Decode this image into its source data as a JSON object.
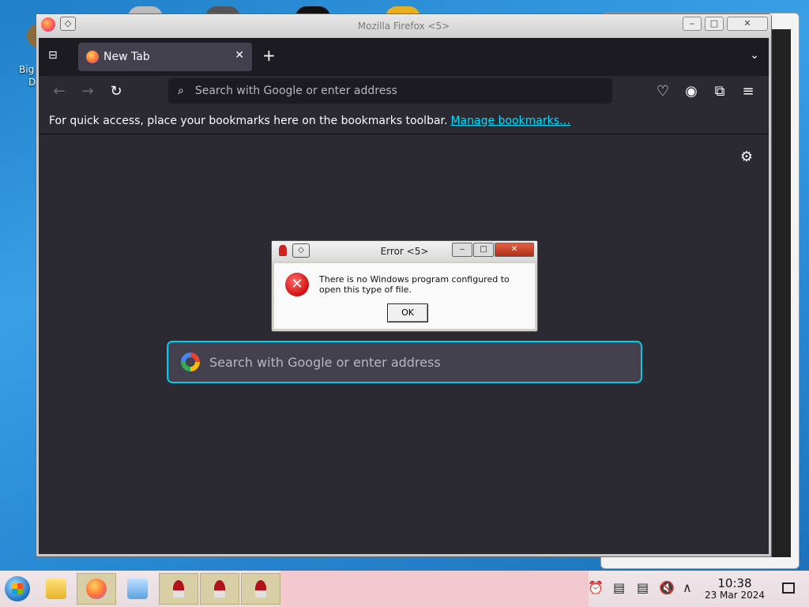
{
  "desktop": {
    "icon_label_line1": "Big",
    "icon_label_line2": "D"
  },
  "window": {
    "title": "Mozilla Firefox <5>",
    "pin_glyph": "◇",
    "minimize": "‒",
    "maximize": "□",
    "close": "✕"
  },
  "browser": {
    "tab_list_glyph": "⊟",
    "tab": {
      "label": "New Tab",
      "close": "✕"
    },
    "newtab_glyph": "+",
    "tablist_menu_glyph": "⌄",
    "nav": {
      "back": "←",
      "forward": "→",
      "reload": "↻",
      "search_glyph": "⌕",
      "urlbar_placeholder": "Search with Google or enter address",
      "pocket": "♡",
      "account": "◉",
      "extensions": "⧉",
      "menu": "≡"
    },
    "bookmarks_bar": {
      "text": "For quick access, place your bookmarks here on the bookmarks toolbar.",
      "link": "Manage bookmarks…"
    },
    "newtab": {
      "settings_glyph": "⚙",
      "search_placeholder": "Search with Google or enter address"
    }
  },
  "dialog": {
    "title": "Error <5>",
    "pin_glyph": "◇",
    "minimize": "‒",
    "maximize": "□",
    "close": "✕",
    "error_glyph": "✕",
    "message": "There is no Windows program configured to open this type of file.",
    "ok": "OK"
  },
  "taskbar": {
    "tray": {
      "alarm": "⏰",
      "clipboard": "▤",
      "mute": "🔇",
      "expand": "∧"
    },
    "clock": {
      "time": "10:38",
      "date": "23 Mar 2024"
    }
  },
  "colors": {
    "ff_bg": "#2b2a33",
    "ff_tabstrip": "#1c1b22",
    "accent_cyan": "#00ddff",
    "taskbar": "#f0e6ea"
  }
}
